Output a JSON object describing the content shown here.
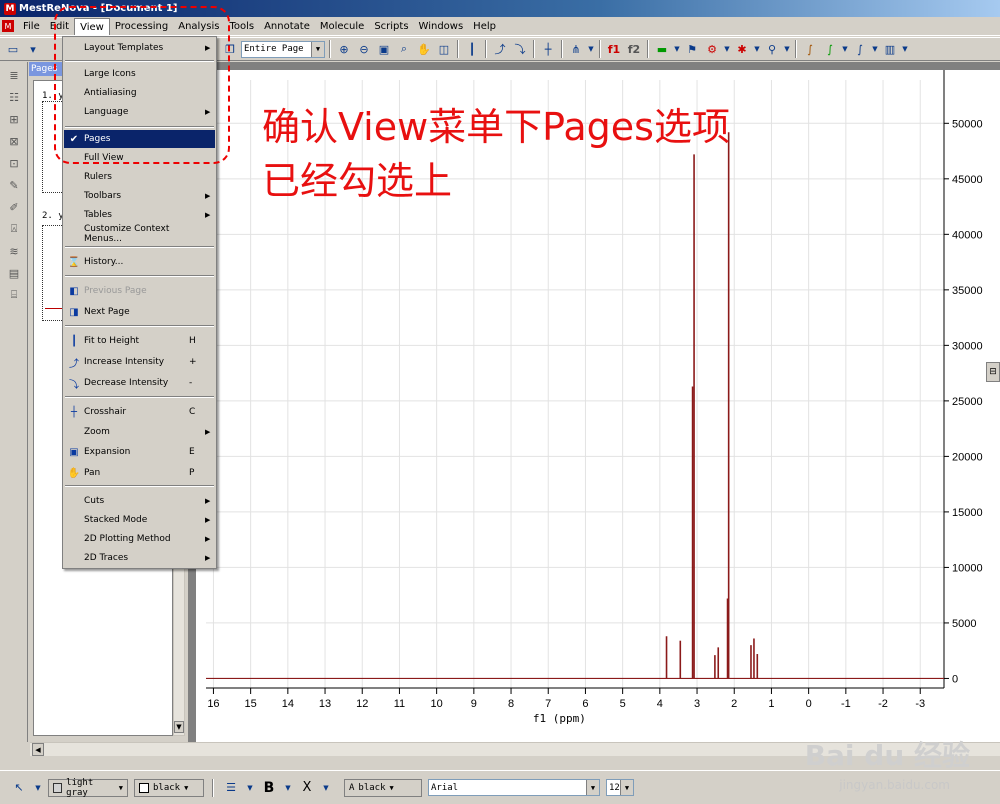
{
  "window": {
    "title": "MestReNova - [Document 1]"
  },
  "menubar": [
    "File",
    "Edit",
    "View",
    "Processing",
    "Analysis",
    "Tools",
    "Annotate",
    "Molecule",
    "Scripts",
    "Windows",
    "Help"
  ],
  "toolbar": {
    "zoom_value": "Entire Page",
    "f1_label": "f1",
    "f2_label": "f2"
  },
  "pages_panel": {
    "header": "Pages",
    "thumb1_label": "1. y",
    "thumb2_label": "2. y"
  },
  "view_menu": {
    "items": [
      {
        "label": "Layout Templates",
        "submenu": true
      },
      {
        "label": "Large Icons"
      },
      {
        "label": "Antialiasing"
      },
      {
        "label": "Language",
        "submenu": true
      },
      {
        "label": "Pages",
        "checked": true,
        "highlighted": true
      },
      {
        "label": "Full View"
      },
      {
        "label": "Rulers"
      },
      {
        "label": "Toolbars",
        "submenu": true
      },
      {
        "label": "Tables",
        "submenu": true
      },
      {
        "label": "Customize Context Menus..."
      },
      {
        "label": "History...",
        "icon": "history-icon"
      },
      {
        "label": "Previous Page",
        "icon": "previous-page-icon",
        "disabled": true
      },
      {
        "label": "Next Page",
        "icon": "next-page-icon"
      },
      {
        "label": "Fit to Height",
        "icon": "fit-height-icon",
        "shortcut": "H"
      },
      {
        "label": "Increase Intensity",
        "icon": "increase-intensity-icon",
        "shortcut": "+"
      },
      {
        "label": "Decrease Intensity",
        "icon": "decrease-intensity-icon",
        "shortcut": "-"
      },
      {
        "label": "Crosshair",
        "icon": "crosshair-icon",
        "shortcut": "C"
      },
      {
        "label": "Zoom",
        "submenu": true
      },
      {
        "label": "Expansion",
        "icon": "expansion-icon",
        "shortcut": "E"
      },
      {
        "label": "Pan",
        "icon": "pan-icon",
        "shortcut": "P"
      },
      {
        "label": "Cuts",
        "submenu": true
      },
      {
        "label": "Stacked Mode",
        "submenu": true
      },
      {
        "label": "2D Plotting Method",
        "submenu": true
      },
      {
        "label": "2D Traces",
        "submenu": true
      }
    ]
  },
  "annotation": {
    "line1": "确认View菜单下Pages选项",
    "line2": "已经勾选上"
  },
  "chart_data": {
    "type": "line",
    "xlabel": "f1 (ppm)",
    "x_ticks": [
      "16",
      "15",
      "14",
      "13",
      "12",
      "11",
      "10",
      "9",
      "8",
      "7",
      "6",
      "5",
      "4",
      "3",
      "2",
      "1",
      "0",
      "-1",
      "-2",
      "-3"
    ],
    "y_ticks": [
      "50000",
      "45000",
      "40000",
      "35000",
      "30000",
      "25000",
      "20000",
      "15000",
      "10000",
      "5000",
      "0"
    ],
    "xlim": [
      16.2,
      -3.8
    ],
    "ylim": [
      -500,
      53000
    ],
    "line_color": "#8b1a1a",
    "peaks": [
      {
        "x": 3.82,
        "y": 3800
      },
      {
        "x": 3.45,
        "y": 3400
      },
      {
        "x": 3.08,
        "y": 47200
      },
      {
        "x": 3.12,
        "y": 26300
      },
      {
        "x": 2.52,
        "y": 2100
      },
      {
        "x": 2.43,
        "y": 2800
      },
      {
        "x": 2.15,
        "y": 49200
      },
      {
        "x": 2.18,
        "y": 7200
      },
      {
        "x": 1.55,
        "y": 3000
      },
      {
        "x": 1.47,
        "y": 3600
      },
      {
        "x": 1.38,
        "y": 2200
      }
    ]
  },
  "bottombar": {
    "fill_color": "light gray",
    "line_color": "black",
    "bold_label": "B",
    "sub_label": "X",
    "text_color": "black",
    "font_name": "Arial",
    "font_size": "12"
  },
  "watermark": {
    "logo": "Bai du 经验",
    "url": "jingyan.baidu.com"
  }
}
